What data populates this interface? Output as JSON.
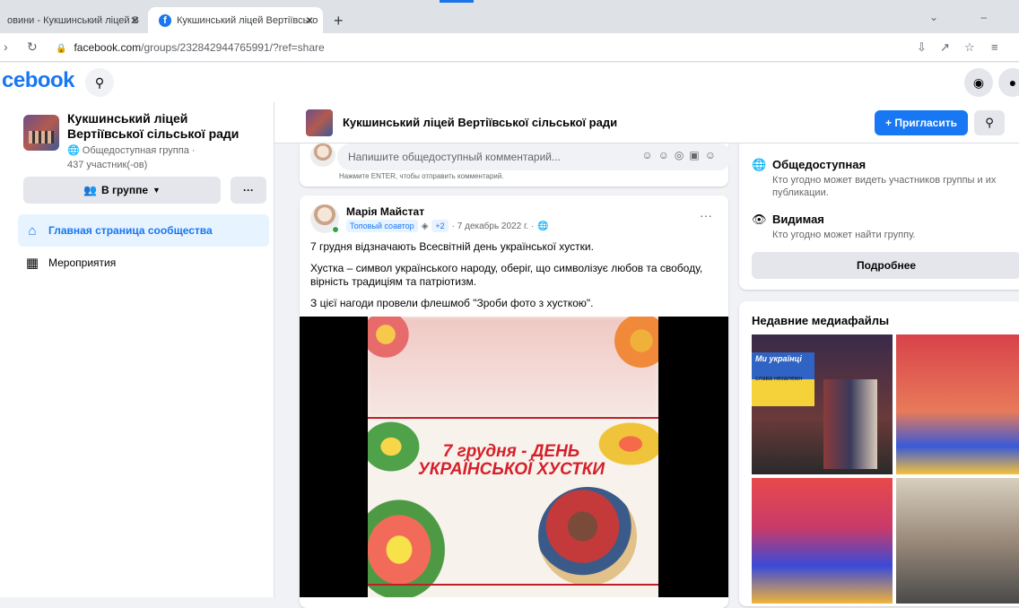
{
  "browser": {
    "tabs": [
      {
        "label": "овини - Кукшинський ліцей В",
        "active": false
      },
      {
        "label": "Кукшинський ліцей Вертіївсько",
        "active": true
      }
    ],
    "new_tab": "+",
    "url_host": "facebook.com",
    "url_path": "/groups/232842944765991/?ref=share"
  },
  "header": {
    "logo": "cebook",
    "icons": [
      "search-icon",
      "messenger-icon",
      "notifications-icon"
    ]
  },
  "sidebar": {
    "group_name": "Кукшинський ліцей Вертіївської сільської ради",
    "privacy": "Общедоступная группа ·",
    "members": "437 участник(-ов)",
    "in_group_button": "В группе",
    "more_button": "···",
    "items": [
      {
        "label": "Главная страница сообщества",
        "icon": "home-icon",
        "active": true
      },
      {
        "label": "Мероприятия",
        "icon": "calendar-icon",
        "active": false
      }
    ]
  },
  "main": {
    "group_title": "Кукшинський ліцей Вертіївської сільської ради",
    "invite_button": "+ Пригласить",
    "comment": {
      "placeholder": "Напишите общедоступный комментарий...",
      "hint": "Нажмите ENTER, чтобы отправить комментарий."
    },
    "post": {
      "author": "Марія Майстат",
      "badge": "Топовый соавтор",
      "extra": "+2",
      "date": "· 7 декабрь 2022 г. ·",
      "more": "···",
      "paragraphs": [
        "7 грудня відзначають Всесвітній день української хустки.",
        "Хустка – символ українського народу, оберіг, що символізує любов та свободу, вірність традиціям та патріотизм.",
        "З цієї нагоди  провели флешмоб  \"Зроби фото з хусткою\"."
      ],
      "image_caption_1": "7 грудня - ДЕНЬ",
      "image_caption_2": "УКРАЇНСЬКОЇ ХУСТКИ"
    }
  },
  "right": {
    "public_title": "Общедоступная",
    "public_desc": "Кто угодно может видеть участников группы и их публикации.",
    "visible_title": "Видимая",
    "visible_desc": "Кто угодно может найти группу.",
    "more_button": "Подробнее",
    "media_title": "Недавние медиафайлы",
    "media_caption": "Ми українці",
    "media_subcaption": "слава незалежн"
  }
}
